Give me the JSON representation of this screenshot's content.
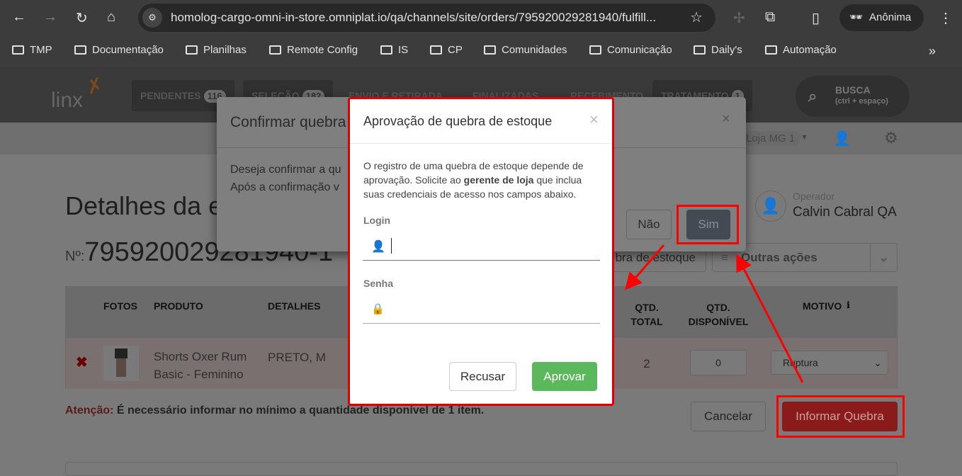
{
  "browser": {
    "url": "homolog-cargo-omni-in-store.omniplat.io/qa/channels/site/orders/795920029281940/fulfill...",
    "profile": "Anônima",
    "bookmarks": [
      "TMP",
      "Documentação",
      "Planilhas",
      "Remote Config",
      "IS",
      "CP",
      "Comunidades",
      "Comunicação",
      "Daily's",
      "Automação"
    ]
  },
  "header": {
    "logo": "linx",
    "tabs": [
      {
        "label": "PENDENTES",
        "count": "116"
      },
      {
        "label": "SELEÇÃO",
        "count": "182"
      },
      {
        "label": "ENVIO E RETIRADA"
      },
      {
        "label": "FINALIZADAS"
      },
      {
        "label": "RECEBIMENTO"
      },
      {
        "label": "TRATAMENTO",
        "count": "1"
      }
    ],
    "search_label": "BUSCA",
    "search_hint": "(ctrl + espaço)",
    "store": "Loja MG 1"
  },
  "page": {
    "title": "Detalhes da e",
    "order_prefix": "Nº:",
    "order_number": "795920029281940-1",
    "operator_label": "Operador",
    "operator_name": "Calvin Cabral QA",
    "break_button": "bra de estoque",
    "other_actions": "Outras ações",
    "table": {
      "headers": [
        "FOTOS",
        "PRODUTO",
        "DETALHES",
        "QTD. TOTAL",
        "QTD. DISPONÍVEL",
        "MOTIVO"
      ],
      "row": {
        "product": "Shorts Oxer Rum Basic - Feminino",
        "details": "PRETO, M",
        "total": "2",
        "available": "0",
        "reason": "Ruptura"
      }
    },
    "warning_label": "Atenção:",
    "warning_text": "É necessário informar no mínimo a quantidade disponível de 1 item.",
    "cancel": "Cancelar",
    "submit": "Informar Quebra"
  },
  "confirm_modal": {
    "title": "Confirmar quebra",
    "line1": "Deseja confirmar a qu",
    "line2": "Após a confirmação v",
    "no": "Não",
    "yes": "Sim"
  },
  "approve_modal": {
    "title": "Aprovação de quebra de estoque",
    "text_before": "O registro de uma quebra de estoque depende de aprovação. Solicite ao ",
    "text_bold": "gerente de loja",
    "text_after": " que inclua suas credenciais de acesso nos campos abaixo.",
    "login_label": "Login",
    "login_value": "",
    "password_label": "Senha",
    "password_value": "",
    "reject": "Recusar",
    "approve": "Aprovar"
  },
  "colors": {
    "annotation": "#ff0000",
    "approve_green": "#5cb85c",
    "submit_red": "#8b1a1a"
  }
}
